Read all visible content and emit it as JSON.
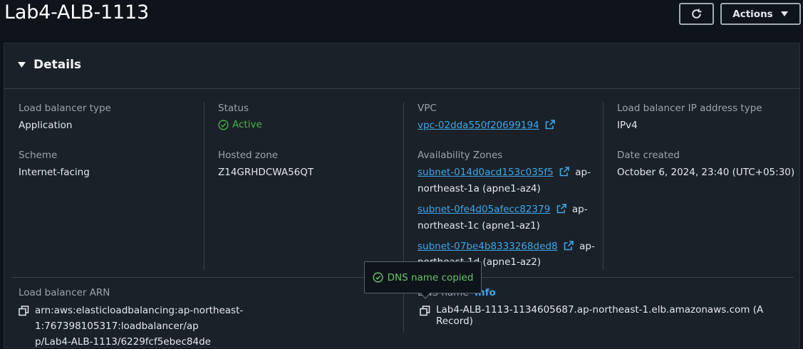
{
  "header": {
    "title": "Lab4-ALB-1113",
    "actions_label": "Actions"
  },
  "details": {
    "title": "Details",
    "lb_type_label": "Load balancer type",
    "lb_type_value": "Application",
    "status_label": "Status",
    "status_value": "Active",
    "vpc_label": "VPC",
    "vpc_value": "vpc-02dda550f20699194",
    "ip_type_label": "Load balancer IP address type",
    "ip_type_value": "IPv4",
    "scheme_label": "Scheme",
    "scheme_value": "Internet-facing",
    "hosted_zone_label": "Hosted zone",
    "hosted_zone_value": "Z14GRHDCWA56QT",
    "az_label": "Availability Zones",
    "subnets": [
      {
        "id": "subnet-014d0acd153c035f5",
        "zone_a": "ap-",
        "zone_b": "northeast-1a (apne1-az4)"
      },
      {
        "id": "subnet-0fe4d05afecc82379",
        "zone_a": "ap-",
        "zone_b": "northeast-1c (apne1-az1)"
      },
      {
        "id": "subnet-07be4b8333268ded8",
        "zone_a": "ap-",
        "zone_b": "northeast-1d (apne1-az2)"
      }
    ],
    "date_label": "Date created",
    "date_value": "October 6, 2024, 23:40 (UTC+05:30)",
    "arn_label": "Load balancer ARN",
    "arn_line1": "arn:aws:elasticloadbalancing:ap-northeast-1:767398105317:loadbalancer/ap",
    "arn_line2": "p/Lab4-ALB-1113/6229fcf5ebec84de",
    "dns_label": "DNS name",
    "dns_info": "Info",
    "dns_value": "Lab4-ALB-1113-1134605687.ap-northeast-1.elb.amazonaws.com (A Record)"
  },
  "tooltip": {
    "text": "DNS name copied"
  },
  "colors": {
    "accent_link": "#3ea6e8",
    "status_green": "#4caf50",
    "panel_bg": "#1b2128"
  }
}
